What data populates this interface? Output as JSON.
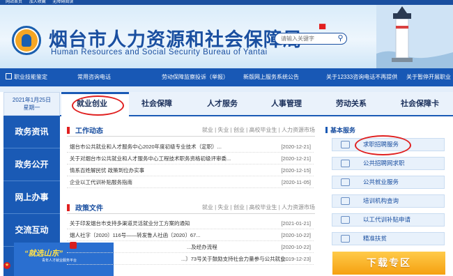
{
  "topbar": {
    "links": [
      "网站首页",
      "加入收藏",
      "无障碍阅读"
    ]
  },
  "header": {
    "title_cn": "烟台市人力资源和社会保障局",
    "title_en": "Human Resources and Social Security Bureau of Yantai",
    "search_placeholder": "请输入关键字",
    "search_icon": "search-icon"
  },
  "navbar": {
    "items": [
      "职业技能鉴定",
      "常用咨询电话",
      "劳动保障监察投诉（举报）",
      "新版网上服务系统公告",
      "关于12333咨询电话不再提供",
      "关于暂停开展职业"
    ]
  },
  "left_sidebar": {
    "date": "2021年1月25日",
    "weekday": "星期一",
    "items": [
      "政务资讯",
      "政务公开",
      "网上办事",
      "交流互动"
    ]
  },
  "promo": {
    "title": "“就选山东”",
    "subtitle": "青年人才就业服务平台"
  },
  "tabs": [
    "就业创业",
    "社会保障",
    "人才服务",
    "人事管理",
    "劳动关系",
    "社会保障卡"
  ],
  "work_news": {
    "title": "工作动态",
    "categories": "就业 | 失业 | 创业 | 高校毕业生 | 人力资源市场",
    "items": [
      {
        "text": "烟台市公共就业和人才服务中心2020年度初级专业技术（定职）...",
        "date": "[2020-12-21]"
      },
      {
        "text": "关于对烟台市公共就业和人才服务中心工程技术职务资格初级评审委...",
        "date": "[2020-12-21]"
      },
      {
        "text": "情系百姓解民忧 政策到位办实事",
        "date": "[2020-12-15]"
      },
      {
        "text": "企业以工代训补贴服务指南",
        "date": "[2020-11-05]"
      }
    ]
  },
  "policy_docs": {
    "title": "政策文件",
    "categories": "就业 | 失业 | 创业 | 高校毕业生 | 人力资源市场",
    "items": [
      {
        "text": "关于印发烟台市支持多渠道灵活就业分工方案的通知",
        "date": "[2021-01-21]"
      },
      {
        "text": "烟人社字〔2020〕116号——转发鲁人社函〔2020〕67...",
        "date": "[2020-10-22]"
      },
      {
        "text": "...及经办流程",
        "date": "[2020-10-22]"
      },
      {
        "text": "...〕73号关于鼓励支持社会力量参与公共就业...",
        "date": "[2019-12-23]"
      }
    ]
  },
  "basic_services": {
    "title": "基本服务",
    "items": [
      "求职招聘服务",
      "公共招聘网求职",
      "公共就业服务",
      "培训机构查询",
      "以工代训补贴申请",
      "精准扶贫"
    ]
  },
  "download": {
    "label": "下载专区"
  },
  "colors": {
    "primary": "#1a5ab5",
    "highlight": "#e02020",
    "accent": "#f5a010"
  }
}
